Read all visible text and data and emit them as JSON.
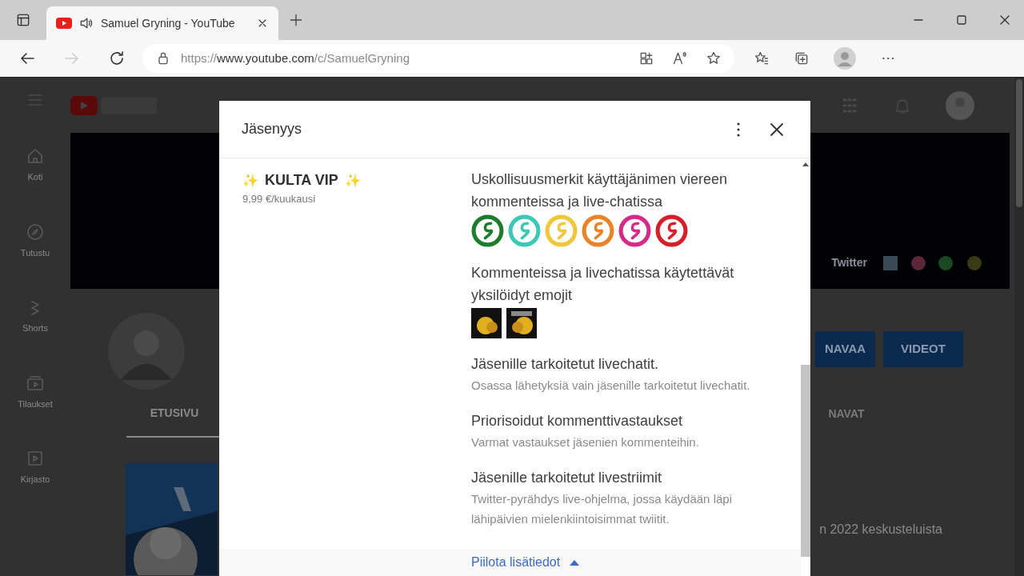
{
  "browser": {
    "tab_title": "Samuel Gryning - YouTube",
    "url_prefix": "https://",
    "url_host": "www.youtube.com",
    "url_path": "/c/SamuelGryning"
  },
  "page": {
    "sidebar": [
      {
        "label": "Koti"
      },
      {
        "label": "Tutustu"
      },
      {
        "label": "Shorts"
      },
      {
        "label": "Tilaukset"
      },
      {
        "label": "Kirjasto"
      }
    ],
    "banner_link": "Twitter",
    "buttons": [
      "NAVAA",
      "VIDEOT"
    ],
    "tabs": [
      {
        "label": "ETUSIVU",
        "selected": true
      },
      {
        "label": "NAVAT",
        "selected": false
      }
    ],
    "text_fragment": "n 2022 keskusteluista"
  },
  "dialog": {
    "title": "Jäsenyys",
    "tier": {
      "sparkle": "✨",
      "name": "KULTA VIP",
      "price": "9,99 €/kuukausi"
    },
    "perks": [
      {
        "kind": "badges",
        "title": "Uskollisuusmerkit käyttäjänimen viereen kommenteissa ja live-chatissa",
        "badges": [
          {
            "color": "#1e7d2c"
          },
          {
            "color": "#3cc8b4"
          },
          {
            "color": "#f0c63a"
          },
          {
            "color": "#e8832a"
          },
          {
            "color": "#d42a8a"
          },
          {
            "color": "#d4202a"
          }
        ]
      },
      {
        "kind": "emojis",
        "title": "Kommenteissa ja livechatissa käytettävät yksilöidyt emojit"
      },
      {
        "kind": "text",
        "title": "Jäsenille tarkoitetut livechatit.",
        "description": "Osassa lähetyksiä vain jäsenille tarkoitetut livechatit."
      },
      {
        "kind": "text",
        "title": "Priorisoidut kommenttivastaukset",
        "description": "Varmat vastaukset jäsenien kommenteihin."
      },
      {
        "kind": "text",
        "title": "Jäsenille tarkoitetut livestriimit",
        "description": "Twitter-pyrähdys live-ohjelma, jossa käydään läpi lähipäivien mielenkiintoisimmat twiitit."
      }
    ],
    "toggle_link": "Piilota lisätiedot"
  }
}
